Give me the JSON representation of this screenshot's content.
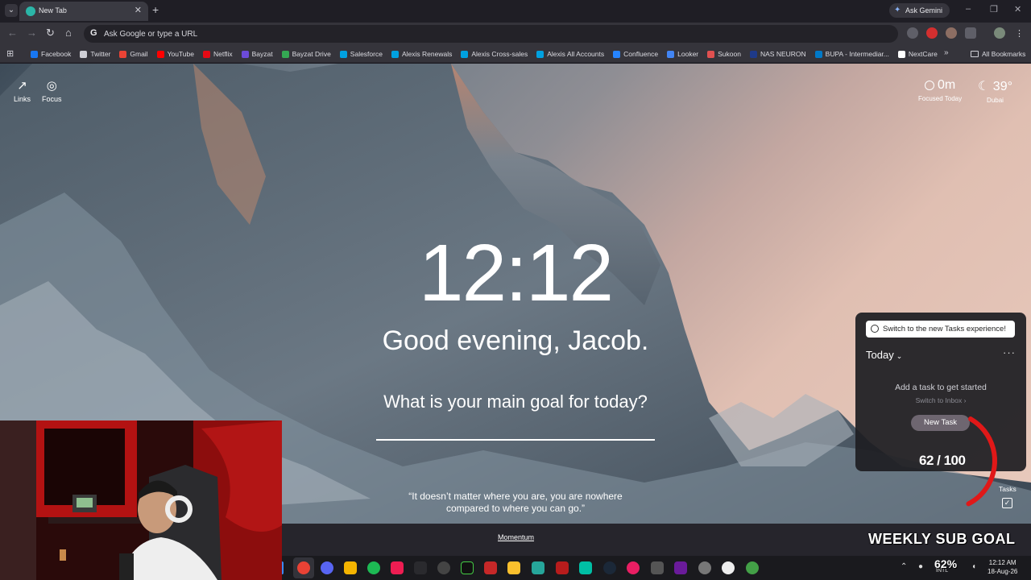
{
  "browser": {
    "tab": {
      "title": "New Tab"
    },
    "ask_gemini": "Ask Gemini",
    "omnibox": {
      "placeholder": "Ask Google or type a URL"
    },
    "bookmarks": [
      {
        "label": "Facebook",
        "color": "#1877f2"
      },
      {
        "label": "Twitter",
        "color": "#cfcfd6"
      },
      {
        "label": "Gmail",
        "color": "#ea4335"
      },
      {
        "label": "YouTube",
        "color": "#ff0000"
      },
      {
        "label": "Netflix",
        "color": "#e50914"
      },
      {
        "label": "Bayzat",
        "color": "#6c4bd8"
      },
      {
        "label": "Bayzat Drive",
        "color": "#34a853"
      },
      {
        "label": "Salesforce",
        "color": "#00a1e0"
      },
      {
        "label": "Alexis Renewals",
        "color": "#00a1e0"
      },
      {
        "label": "Alexis Cross-sales",
        "color": "#00a1e0"
      },
      {
        "label": "Alexis All Accounts",
        "color": "#00a1e0"
      },
      {
        "label": "Confluence",
        "color": "#2684ff"
      },
      {
        "label": "Looker",
        "color": "#4285f4"
      },
      {
        "label": "Sukoon",
        "color": "#e05050"
      },
      {
        "label": "NAS NEURON",
        "color": "#1e3a8a"
      },
      {
        "label": "BUPA - Intermediar...",
        "color": "#0079c8"
      },
      {
        "label": "NextCare",
        "color": "#ffffff"
      }
    ],
    "all_bookmarks": "All Bookmarks"
  },
  "momentum": {
    "links_label": "Links",
    "focus_label": "Focus",
    "focused_value": "0m",
    "focused_label": "Focused Today",
    "weather_temp": "39°",
    "weather_city": "Dubai",
    "time": "12:12",
    "greeting": "Good evening, Jacob.",
    "goal_question": "What is your main goal for today?",
    "quote": "“It doesn’t matter where you are, you are nowhere compared to where you can go.”",
    "footer_brand": "Momentum",
    "tasks": {
      "switch_label": "Switch to the new Tasks experience!",
      "list_name": "Today",
      "empty_message": "Add a task to get started",
      "inbox_link": "Switch to Inbox ›",
      "new_task": "New Task",
      "toggle_label": "Tasks"
    }
  },
  "overlay": {
    "sub_goal_count": "62 / 100",
    "sub_goal_progress": 0.62,
    "weekly_title": "WEEKLY SUB GOAL"
  },
  "taskbar": {
    "battery": "62%",
    "lang": "INTL",
    "time": "12:12 AM",
    "date": "18-Aug-26"
  }
}
